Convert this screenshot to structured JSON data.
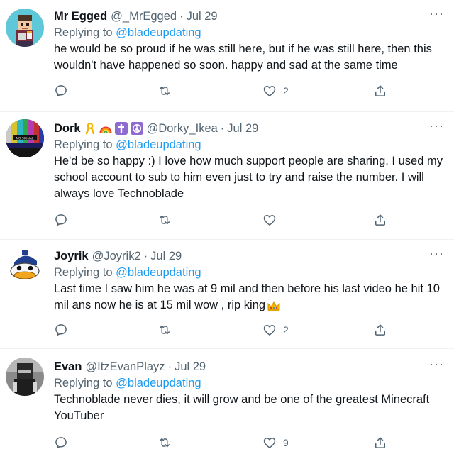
{
  "tweets": [
    {
      "name": "Mr Egged",
      "handle": "@_MrEgged",
      "separator": "·",
      "date": "Jul 29",
      "replying_prefix": "Replying to",
      "replying_to": "@bladeupdating",
      "text": "he would be so proud if he was still here, but if he was still here, then this wouldn't have happened so soon. happy and sad at the same time",
      "likes": "2",
      "more": "···"
    },
    {
      "name": "Dork",
      "badges": [
        "yellow-ribbon-emoji",
        "rainbow-emoji",
        "latin-cross-emoji",
        "peace-symbol-emoji"
      ],
      "handle": "@Dorky_Ikea",
      "separator": "·",
      "date": "Jul 29",
      "replying_prefix": "Replying to",
      "replying_to": "@bladeupdating",
      "text": "He'd be so happy :) I love how much support people are sharing. I used my school account to sub to him even just to try and raise the number. I will always love Technoblade",
      "likes": "",
      "more": "···"
    },
    {
      "name": "Joyrik",
      "handle": "@Joyrik2",
      "separator": "·",
      "date": "Jul 29",
      "replying_prefix": "Replying to",
      "replying_to": "@bladeupdating",
      "text": "Last time I saw him he was at 9 mil and then before his last video he hit 10 mil ans now he is at 15 mil wow , rip king",
      "trailing_emoji": "crown-emoji",
      "likes": "2",
      "more": "···"
    },
    {
      "name": "Evan",
      "handle": "@ItzEvanPlayz",
      "separator": "·",
      "date": "Jul 29",
      "replying_prefix": "Replying to",
      "replying_to": "@bladeupdating",
      "text": "Technoblade never dies, it will grow and be one of the greatest Minecraft YouTuber",
      "likes": "9",
      "more": "···"
    }
  ],
  "colors": {
    "link": "#1d9bf0",
    "secondary_text": "#536471",
    "primary_text": "#0f1419",
    "divider": "#eff3f4"
  },
  "icons": {
    "reply": "reply-icon",
    "retweet": "retweet-icon",
    "like": "heart-icon",
    "share": "share-icon",
    "more": "more-icon"
  }
}
